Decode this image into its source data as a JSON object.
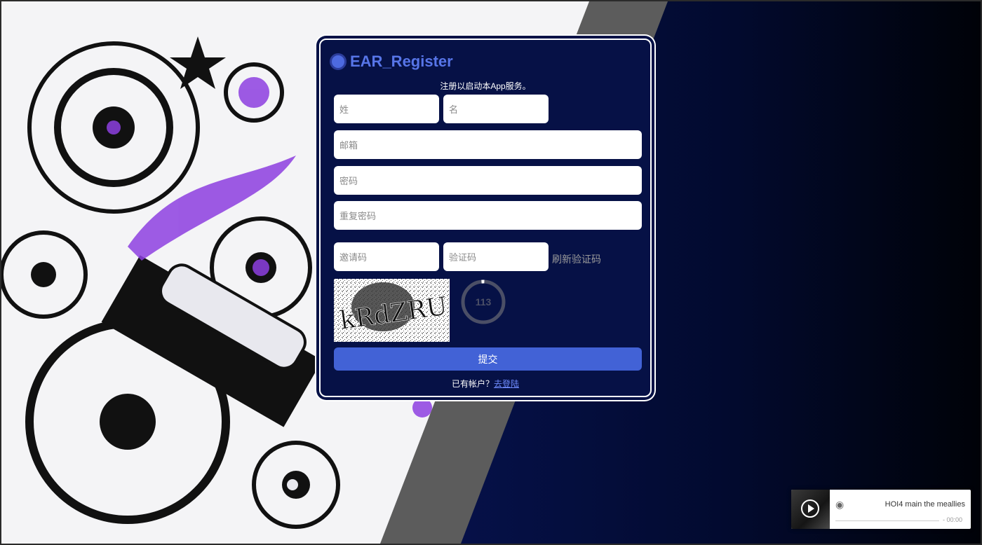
{
  "form": {
    "title": "EAR_Register",
    "subtitle": "注册以启动本App服务。",
    "last_name_placeholder": "姓",
    "first_name_placeholder": "名",
    "email_placeholder": "邮箱",
    "password_placeholder": "密码",
    "repeat_password_placeholder": "重复密码",
    "invite_code_placeholder": "邀请码",
    "captcha_placeholder": "验证码",
    "refresh_captcha_label": "刷新验证码",
    "captcha_text": "kRdZRU",
    "countdown": "113",
    "submit_label": "提交",
    "have_account_text": "已有帐户？",
    "login_link_label": "去登陆"
  },
  "player": {
    "track_title": "HOI4 main the meallies",
    "time": "- 00:00",
    "logo_icon": "netease-music-icon"
  },
  "colors": {
    "accent": "#4262d6",
    "title": "#5775e8",
    "card_bg": "#061146",
    "page_bg": "#06114a"
  }
}
